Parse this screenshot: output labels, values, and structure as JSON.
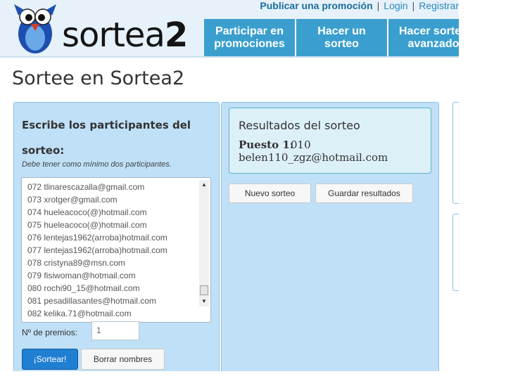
{
  "header": {
    "logo_text_light": "sortea",
    "logo_text_bold": "2",
    "top_links": {
      "publish": "Publicar una promoción",
      "separator": "|",
      "login": "Login",
      "register": "Registrar"
    },
    "nav_tabs": [
      {
        "label": "Participar en\npromociones"
      },
      {
        "label": "Hacer un\nsorteo"
      },
      {
        "label": "Hacer sorteo\navanzado"
      }
    ]
  },
  "page_title": "Sortee en Sortea2",
  "left_panel": {
    "heading": "Escribe los participantes del sorteo:",
    "hint": "Debe tener como mínimo dos participantes.",
    "participants": [
      "072 tlinarescazalla@gmail.com",
      "073 xrotger@gmail.com",
      "074 hueleacoco(@)hotmail.com",
      "075 hueleacoco(@)hotmail.com",
      "076 lentejas1962(arroba)hotmail.com",
      "077 lentejas1962(arroba)hotmail.com",
      "078 cristyna89@msn.com",
      "079 fisiwoman@hotmail.com",
      "080 rochi90_15@hotmail.com",
      "081 pesadillasantes@hotmail.com",
      "082 kelika.71@hotmail.com"
    ],
    "premios_label": "Nº de premios:",
    "premios_value": "1",
    "sortear_button": "¡Sortear!",
    "borrar_button": "Borrar nombres"
  },
  "results_panel": {
    "title": "Resultados del sorteo",
    "winner_label": "Puesto 1:",
    "winner_number": "010",
    "winner_email": "belen110_zgz@hotmail.com",
    "new_button": "Nuevo sorteo",
    "save_button": "Guardar resultados"
  },
  "colors": {
    "nav_blue": "#3a9fce",
    "panel_blue": "#bfe0f7",
    "primary_button": "#1f7fd1",
    "link_blue": "#2a87b7"
  }
}
